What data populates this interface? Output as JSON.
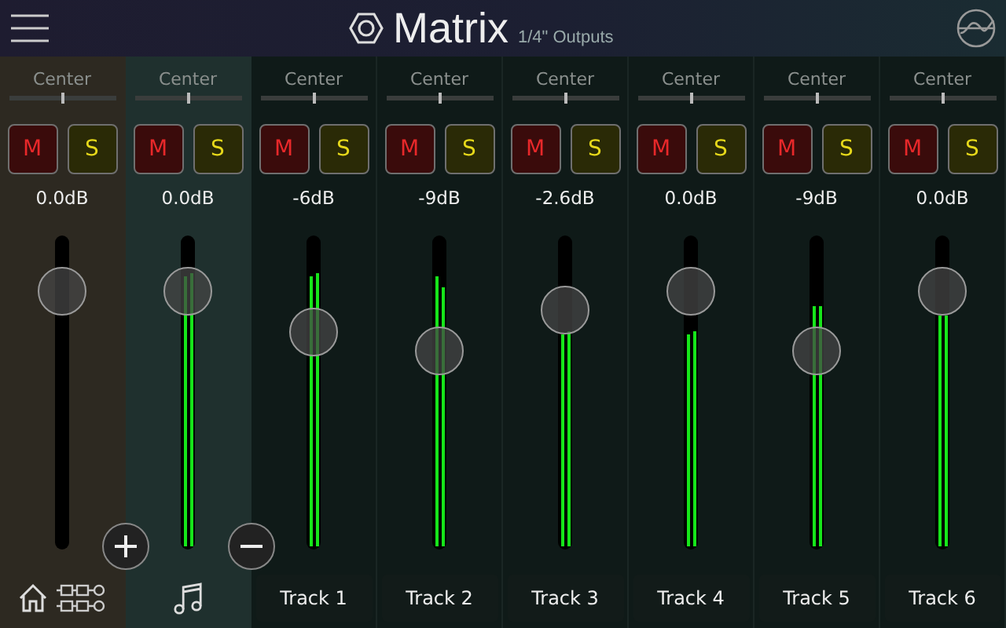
{
  "header": {
    "title": "Matrix",
    "subtitle": "1/4\" Outputs"
  },
  "strips": [
    {
      "kind": "master",
      "pan": {
        "label": "Center",
        "level": 0.5
      },
      "mute": {
        "label": "M",
        "on": false
      },
      "solo": {
        "label": "S",
        "on": false
      },
      "gain": "0.0dB",
      "fader": {
        "level": 0.84
      }
    },
    {
      "kind": "input",
      "pan": {
        "label": "Center",
        "level": 0.5
      },
      "mute": {
        "label": "M",
        "on": false
      },
      "solo": {
        "label": "S",
        "on": false
      },
      "gain": "0.0dB",
      "fader": {
        "level": 0.84
      },
      "meters": [
        {
          "level": 0.88
        },
        {
          "level": 0.89
        }
      ]
    },
    {
      "kind": "track",
      "name": "Track 1",
      "pan": {
        "label": "Center",
        "level": 0.5
      },
      "mute": {
        "label": "M",
        "on": false
      },
      "solo": {
        "label": "S",
        "on": false
      },
      "gain": "-6dB",
      "fader": {
        "level": 0.71
      },
      "meters": [
        {
          "level": 0.88
        },
        {
          "level": 0.89
        }
      ]
    },
    {
      "kind": "track",
      "name": "Track 2",
      "pan": {
        "label": "Center",
        "level": 0.5
      },
      "mute": {
        "label": "M",
        "on": false
      },
      "solo": {
        "label": "S",
        "on": false
      },
      "gain": "-9dB",
      "fader": {
        "level": 0.65
      },
      "meters": [
        {
          "level": 0.88
        },
        {
          "level": 0.84
        }
      ]
    },
    {
      "kind": "track",
      "name": "Track 3",
      "pan": {
        "label": "Center",
        "level": 0.5
      },
      "mute": {
        "label": "M",
        "on": false
      },
      "solo": {
        "label": "S",
        "on": false
      },
      "gain": "-2.6dB",
      "fader": {
        "level": 0.78
      },
      "meters": [
        {
          "level": 0.69
        },
        {
          "level": 0.7
        }
      ]
    },
    {
      "kind": "track",
      "name": "Track 4",
      "pan": {
        "label": "Center",
        "level": 0.5
      },
      "mute": {
        "label": "M",
        "on": false
      },
      "solo": {
        "label": "S",
        "on": false
      },
      "gain": "0.0dB",
      "fader": {
        "level": 0.84
      },
      "meters": [
        {
          "level": 0.69
        },
        {
          "level": 0.7
        }
      ]
    },
    {
      "kind": "track",
      "name": "Track 5",
      "pan": {
        "label": "Center",
        "level": 0.5
      },
      "mute": {
        "label": "M",
        "on": false
      },
      "solo": {
        "label": "S",
        "on": false
      },
      "gain": "-9dB",
      "fader": {
        "level": 0.65
      },
      "meters": [
        {
          "level": 0.78
        },
        {
          "level": 0.78
        }
      ]
    },
    {
      "kind": "track",
      "name": "Track 6",
      "pan": {
        "label": "Center",
        "level": 0.5
      },
      "mute": {
        "label": "M",
        "on": false
      },
      "solo": {
        "label": "S",
        "on": false
      },
      "gain": "0.0dB",
      "fader": {
        "level": 0.84
      },
      "meters": [
        {
          "level": 0.75
        },
        {
          "level": 0.75
        }
      ]
    }
  ]
}
